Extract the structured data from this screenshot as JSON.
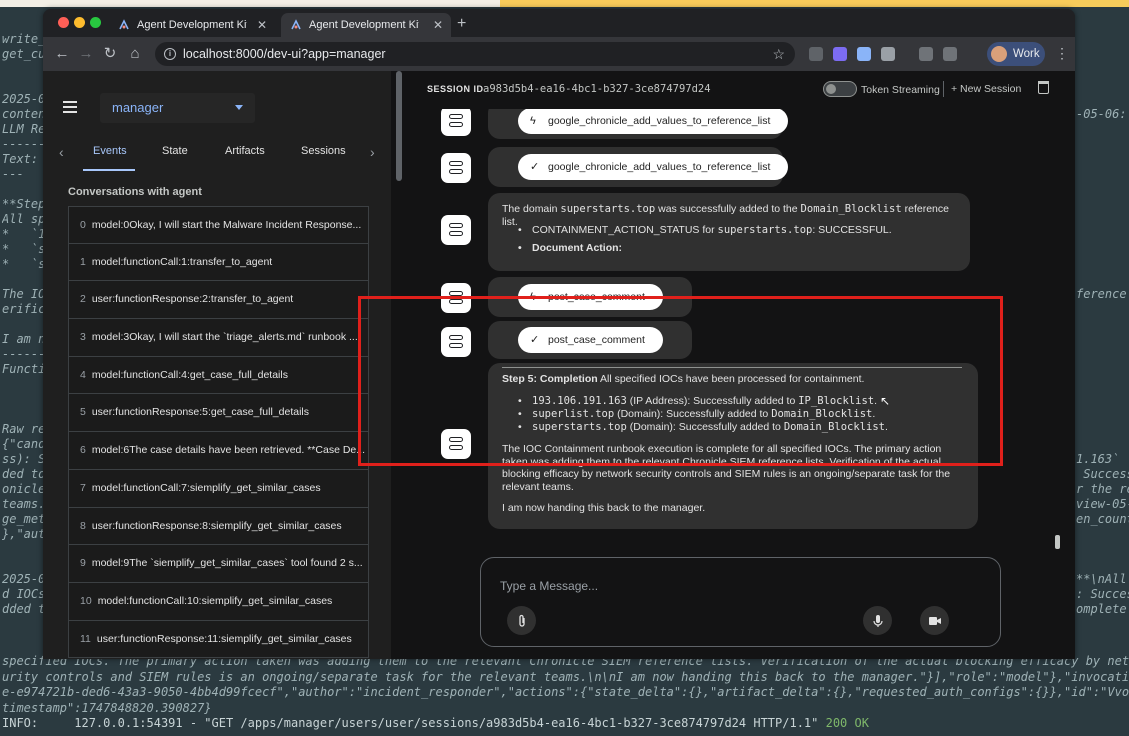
{
  "terminal": {
    "left_lines": [
      "write_",
      "get_cu",
      "",
      "",
      "2025-0",
      "conten",
      "LLM Re",
      "------",
      "Text:",
      "---",
      "",
      "**Step",
      "All sp",
      "*   `1",
      "*   `s",
      "*   `s",
      "",
      "The IO",
      "erific",
      "",
      "I am n",
      "------",
      "Functi",
      "",
      "",
      "",
      "Raw re",
      "{\"cand",
      "ss): S",
      "ded to",
      "onicle",
      "teams.\\",
      "ge_met",
      "},\"aut",
      "",
      "",
      "2025-0",
      "d IOCs",
      "dded t"
    ],
    "right_lines": [
      "",
      "",
      "",
      "",
      "",
      "-05-06:",
      "",
      "",
      "",
      "",
      "",
      "",
      "",
      "",
      "",
      "",
      "",
      "ference",
      "",
      "",
      "",
      "",
      "",
      "",
      "",
      "",
      "",
      "",
      "1.163`",
      " Success",
      "r the re",
      "view-05-",
      "en_count",
      "",
      "",
      "",
      "**\\nAll",
      ": Succes",
      "omplete"
    ],
    "bottom_lines": [
      "specified IOCs. The primary action taken was adding them to the relevant Chronicle SIEM reference lists. Verification of the actual blocking efficacy by net",
      "urity controls and SIEM rules is an ongoing/separate task for the relevant teams.\\n\\nI am now handing this back to the manager.\"}],\"role\":\"model\"},\"invocati",
      "e-e974721b-ded6-43a3-9050-4bb4d99fcecf\",\"author\":\"incident_responder\",\"actions\":{\"state_delta\":{},\"artifact_delta\":{},\"requested_auth_configs\":{}},\"id\":\"Vvo",
      "timestamp\":1747848820.390827}"
    ],
    "info_prefix": "INFO:     127.0.0.1:54391 - \"GET /apps/manager/users/user/sessions/a983d5b4-ea16-4bc1-b327-3ce874797d24 HTTP/1.1\" ",
    "info_status": "200 OK"
  },
  "browser": {
    "tabs": [
      {
        "title": "Agent Development Kit Dev UI"
      },
      {
        "title": "Agent Development Kit Dev UI"
      }
    ],
    "url": "localhost:8000/dev-ui?app=manager",
    "profile": "Work"
  },
  "sidebar": {
    "app_name": "manager",
    "tabs": [
      "Events",
      "State",
      "Artifacts",
      "Sessions"
    ],
    "conversations_title": "Conversations with agent",
    "events": [
      {
        "idx": "0",
        "text": "model:0Okay, I will start the Malware Incident Response..."
      },
      {
        "idx": "1",
        "text": "model:functionCall:1:transfer_to_agent"
      },
      {
        "idx": "2",
        "text": "user:functionResponse:2:transfer_to_agent"
      },
      {
        "idx": "3",
        "text": "model:3Okay, I will start the `triage_alerts.md` runbook ..."
      },
      {
        "idx": "4",
        "text": "model:functionCall:4:get_case_full_details"
      },
      {
        "idx": "5",
        "text": "user:functionResponse:5:get_case_full_details"
      },
      {
        "idx": "6",
        "text": "model:6The case details have been retrieved. **Case De..."
      },
      {
        "idx": "7",
        "text": "model:functionCall:7:siemplify_get_similar_cases"
      },
      {
        "idx": "8",
        "text": "user:functionResponse:8:siemplify_get_similar_cases"
      },
      {
        "idx": "9",
        "text": "model:9The `siemplify_get_similar_cases` tool found 2 s..."
      },
      {
        "idx": "10",
        "text": "model:functionCall:10:siemplify_get_similar_cases"
      },
      {
        "idx": "11",
        "text": "user:functionResponse:11:siemplify_get_similar_cases"
      }
    ]
  },
  "main": {
    "session_label": "SESSION ID",
    "session_id": "a983d5b4-ea16-4bc1-b327-3ce874797d24",
    "token_streaming": "Token Streaming",
    "new_session": "+ New Session",
    "pill_top_call": "google_chronicle_add_values_to_reference_list",
    "pill_top_resp": "google_chronicle_add_values_to_reference_list",
    "domain_msg": {
      "pre": "The domain ",
      "domain": "superstarts.top",
      "mid": " was successfully added to the ",
      "list": "Domain_Blocklist",
      "post": " reference list.",
      "b1_pre": "CONTAINMENT_ACTION_STATUS for ",
      "b1_domain": "superstarts.top",
      "b1_post": ": SUCCESSFUL.",
      "b2": "Document Action:"
    },
    "pill_case_call": "post_case_comment",
    "pill_case_resp": "post_case_comment",
    "completion": {
      "heading": "Step 5: Completion",
      "heading_rest": " All specified IOCs have been processed for containment.",
      "items": [
        {
          "value": "193.106.191.163",
          "desc": " (IP Address): Successfully added to ",
          "list": "IP_Blocklist",
          "end": "."
        },
        {
          "value": "superlist.top",
          "desc": " (Domain): Successfully added to ",
          "list": "Domain_Blocklist",
          "end": "."
        },
        {
          "value": "superstarts.top",
          "desc": " (Domain): Successfully added to ",
          "list": "Domain_Blocklist",
          "end": "."
        }
      ],
      "para1": "The IOC Containment runbook execution is complete for all specified IOCs. The primary action taken was adding them to the relevant Chronicle SIEM reference lists. Verification of the actual blocking efficacy by network security controls and SIEM rules is an ongoing/separate task for the relevant teams.",
      "para2": "I am now handing this back to the manager."
    },
    "composer_placeholder": "Type a Message..."
  },
  "icons": {
    "call": "lightning-icon",
    "response": "check-icon",
    "attach": "paperclip-icon",
    "mic": "microphone-icon",
    "video": "video-camera-icon"
  },
  "colors": {
    "highlight": "#e0201b",
    "accent": "#a8c7fa"
  }
}
